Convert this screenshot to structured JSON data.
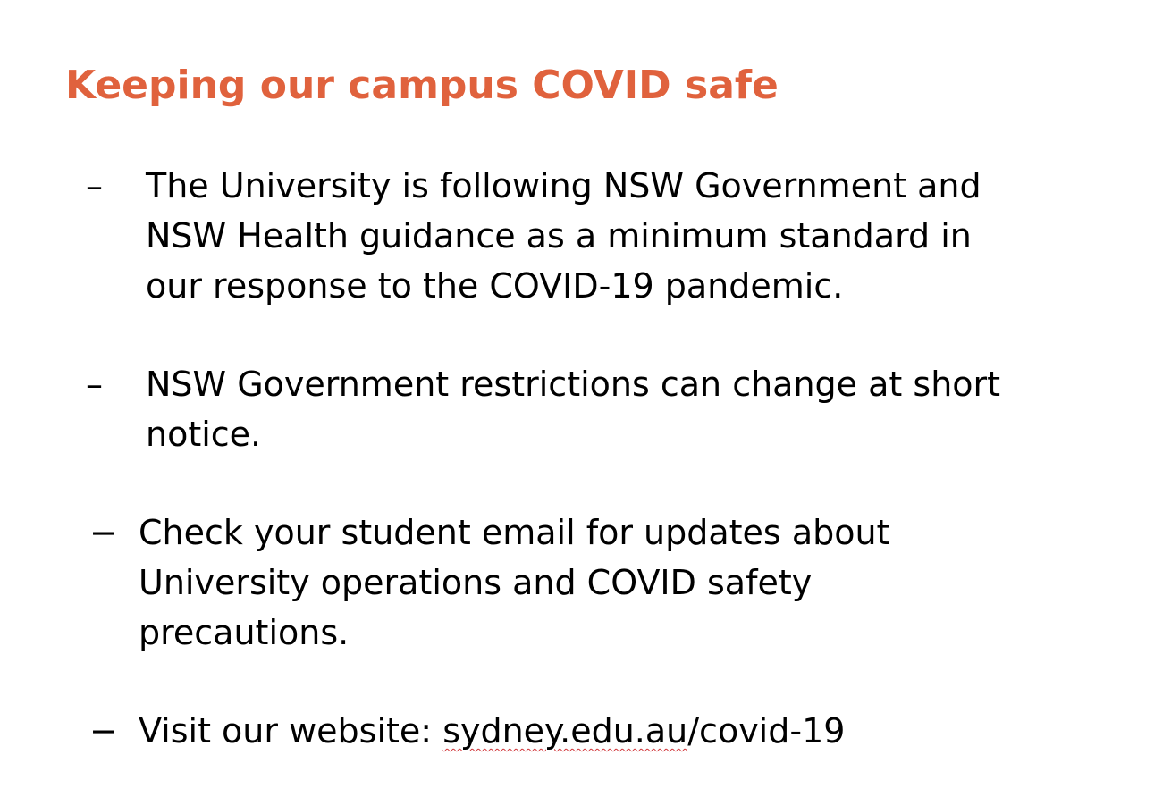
{
  "slide": {
    "title": "Keeping our campus COVID safe",
    "accent_color": "#e0623d",
    "bullets": [
      {
        "dash": "–",
        "lines": [
          "The University is following NSW Government and",
          "NSW Health guidance as a minimum standard in",
          "our response to the COVID-19 pandemic."
        ]
      },
      {
        "dash": "–",
        "lines": [
          "NSW Government restrictions can change at short",
          "notice."
        ]
      },
      {
        "dash": "−",
        "lines": [
          "Check your student email for updates about",
          "University operations and COVID safety",
          "precautions."
        ]
      },
      {
        "dash": "−",
        "prefix": "Visit our website: ",
        "link_text": "sydney.edu.au",
        "suffix": "/covid-19",
        "spellcheck_underline_color": "#d13438"
      }
    ]
  }
}
